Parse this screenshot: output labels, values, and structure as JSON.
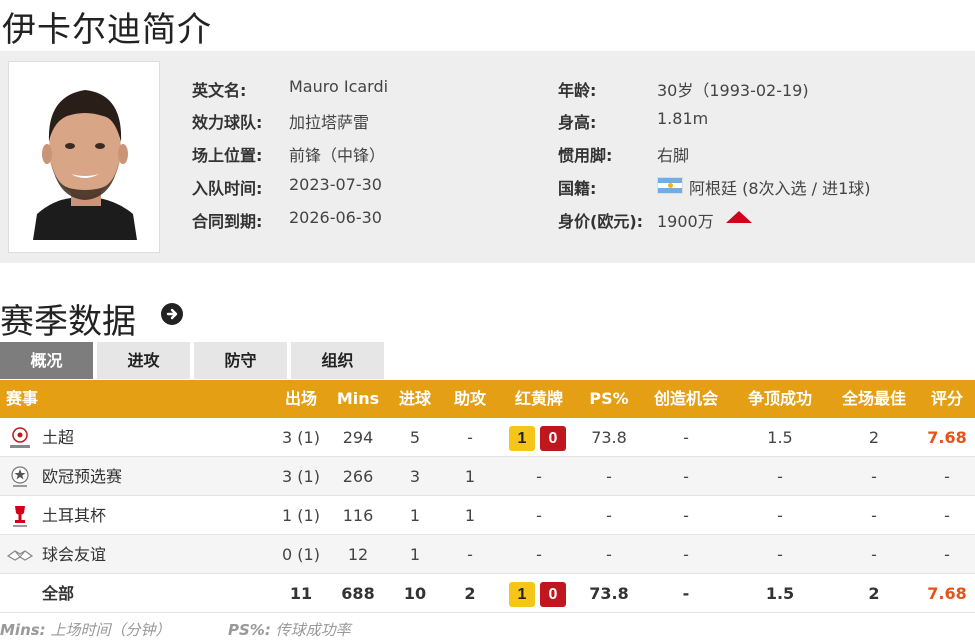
{
  "page": {
    "title": "伊卡尔迪简介"
  },
  "profile": {
    "english_name": {
      "label": "英文名:",
      "value": "Mauro Icardi"
    },
    "club": {
      "label": "效力球队:",
      "value": "加拉塔萨雷"
    },
    "position": {
      "label": "场上位置:",
      "value": "前锋（中锋）"
    },
    "joined": {
      "label": "入队时间:",
      "value": "2023-07-30"
    },
    "contract": {
      "label": "合同到期:",
      "value": "2026-06-30"
    },
    "age": {
      "label": "年龄:",
      "value": "30岁（1993-02-19)"
    },
    "height": {
      "label": "身高:",
      "value": "1.81m"
    },
    "foot": {
      "label": "惯用脚:",
      "value": "右脚"
    },
    "nationality": {
      "label": "国籍:",
      "value": "阿根廷 (8次入选 / 进1球)",
      "flag_icon": "argentina-flag-icon"
    },
    "market_value": {
      "label": "身价(欧元):",
      "value": "1900万",
      "trend_icon": "trend-up-icon",
      "trend_color": "#d0021b"
    }
  },
  "season": {
    "title": "赛季数据",
    "tabs": [
      "概况",
      "进攻",
      "防守",
      "组织"
    ],
    "active_tab": "概况"
  },
  "table": {
    "header_color": "#e49f14",
    "headers": [
      "赛事",
      "出场",
      "Mins",
      "进球",
      "助攻",
      "红黄牌",
      "PS%",
      "创造机会",
      "争顶成功",
      "全场最佳",
      "评分"
    ],
    "rows": [
      {
        "competition": "土超",
        "icon": "super-lig-logo-icon",
        "apps": "3 (1)",
        "mins": "294",
        "goals": "5",
        "assists": "-",
        "yellow": "1",
        "red": "0",
        "ps": "73.8",
        "chances": "-",
        "aerials": "1.5",
        "motm": "2",
        "rating": "7.68"
      },
      {
        "competition": "欧冠预选赛",
        "icon": "champions-league-logo-icon",
        "apps": "3 (1)",
        "mins": "266",
        "goals": "3",
        "assists": "1",
        "cards": "-",
        "ps": "-",
        "chances": "-",
        "aerials": "-",
        "motm": "-",
        "rating": "-"
      },
      {
        "competition": "土耳其杯",
        "icon": "turkish-cup-logo-icon",
        "apps": "1 (1)",
        "mins": "116",
        "goals": "1",
        "assists": "1",
        "cards": "-",
        "ps": "-",
        "chances": "-",
        "aerials": "-",
        "motm": "-",
        "rating": "-"
      },
      {
        "competition": "球会友谊",
        "icon": "club-friendly-logo-icon",
        "apps": "0 (1)",
        "mins": "12",
        "goals": "1",
        "assists": "-",
        "cards": "-",
        "ps": "-",
        "chances": "-",
        "aerials": "-",
        "motm": "-",
        "rating": "-"
      }
    ],
    "total": {
      "competition": "全部",
      "apps": "11",
      "mins": "688",
      "goals": "10",
      "assists": "2",
      "yellow": "1",
      "red": "0",
      "ps": "73.8",
      "chances": "-",
      "aerials": "1.5",
      "motm": "2",
      "rating": "7.68"
    }
  },
  "footnotes": {
    "mins_key": "Mins:",
    "mins_text": "上场时间（分钟）",
    "ps_key": "PS%:",
    "ps_text": "传球成功率"
  }
}
